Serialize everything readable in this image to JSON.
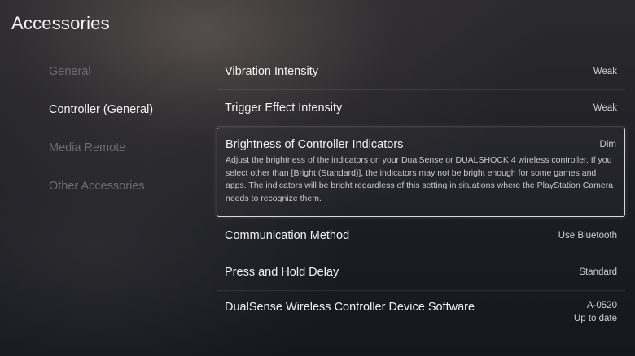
{
  "page": {
    "title": "Accessories"
  },
  "sidebar": {
    "items": [
      {
        "label": "General",
        "active": false
      },
      {
        "label": "Controller (General)",
        "active": true
      },
      {
        "label": "Media Remote",
        "active": false
      },
      {
        "label": "Other Accessories",
        "active": false
      }
    ]
  },
  "settings": {
    "vibration": {
      "label": "Vibration Intensity",
      "value": "Weak"
    },
    "trigger": {
      "label": "Trigger Effect Intensity",
      "value": "Weak"
    },
    "brightness": {
      "label": "Brightness of Controller Indicators",
      "value": "Dim",
      "description": "Adjust the brightness of the indicators on your DualSense or DUALSHOCK 4 wireless controller. If you select other than [Bright (Standard)], the indicators may not be bright enough for some games and apps. The indicators will be bright regardless of this setting in situations where the PlayStation Camera needs to recognize them."
    },
    "communication": {
      "label": "Communication Method",
      "value": "Use Bluetooth"
    },
    "press_hold": {
      "label": "Press and Hold Delay",
      "value": "Standard"
    },
    "device_software": {
      "label": "DualSense Wireless Controller Device Software",
      "version": "A-0520",
      "status": "Up to date"
    }
  }
}
